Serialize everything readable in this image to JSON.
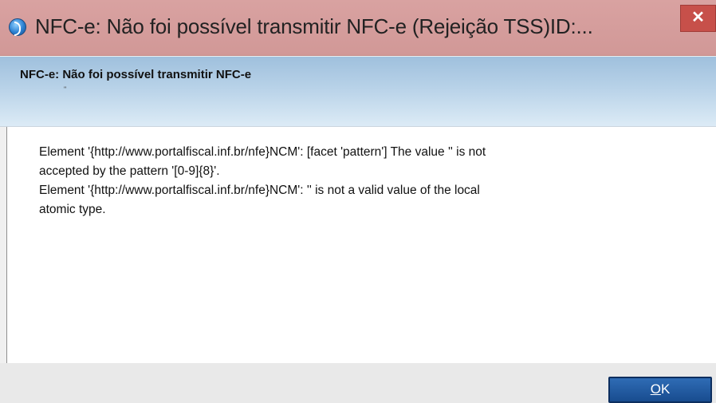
{
  "window": {
    "title": "NFC-e: Não foi possível transmitir NFC-e (Rejeição TSS)ID:...",
    "close_label": "✕"
  },
  "header": {
    "title": "NFC-e: Não foi possível transmitir NFC-e",
    "subtitle": "\""
  },
  "message": {
    "lines": [
      "Element '{http://www.portalfiscal.inf.br/nfe}NCM': [facet 'pattern'] The value '' is not",
      "accepted by the pattern '[0-9]{8}'.",
      "Element '{http://www.portalfiscal.inf.br/nfe}NCM': '' is not a valid value of the local",
      "atomic type."
    ]
  },
  "footer": {
    "ok_mnemonic": "O",
    "ok_rest": "K"
  },
  "colors": {
    "titlebar": "#d19897",
    "close": "#c7504a",
    "header_band": "#b8d2e8",
    "ok_button": "#184c8f"
  }
}
